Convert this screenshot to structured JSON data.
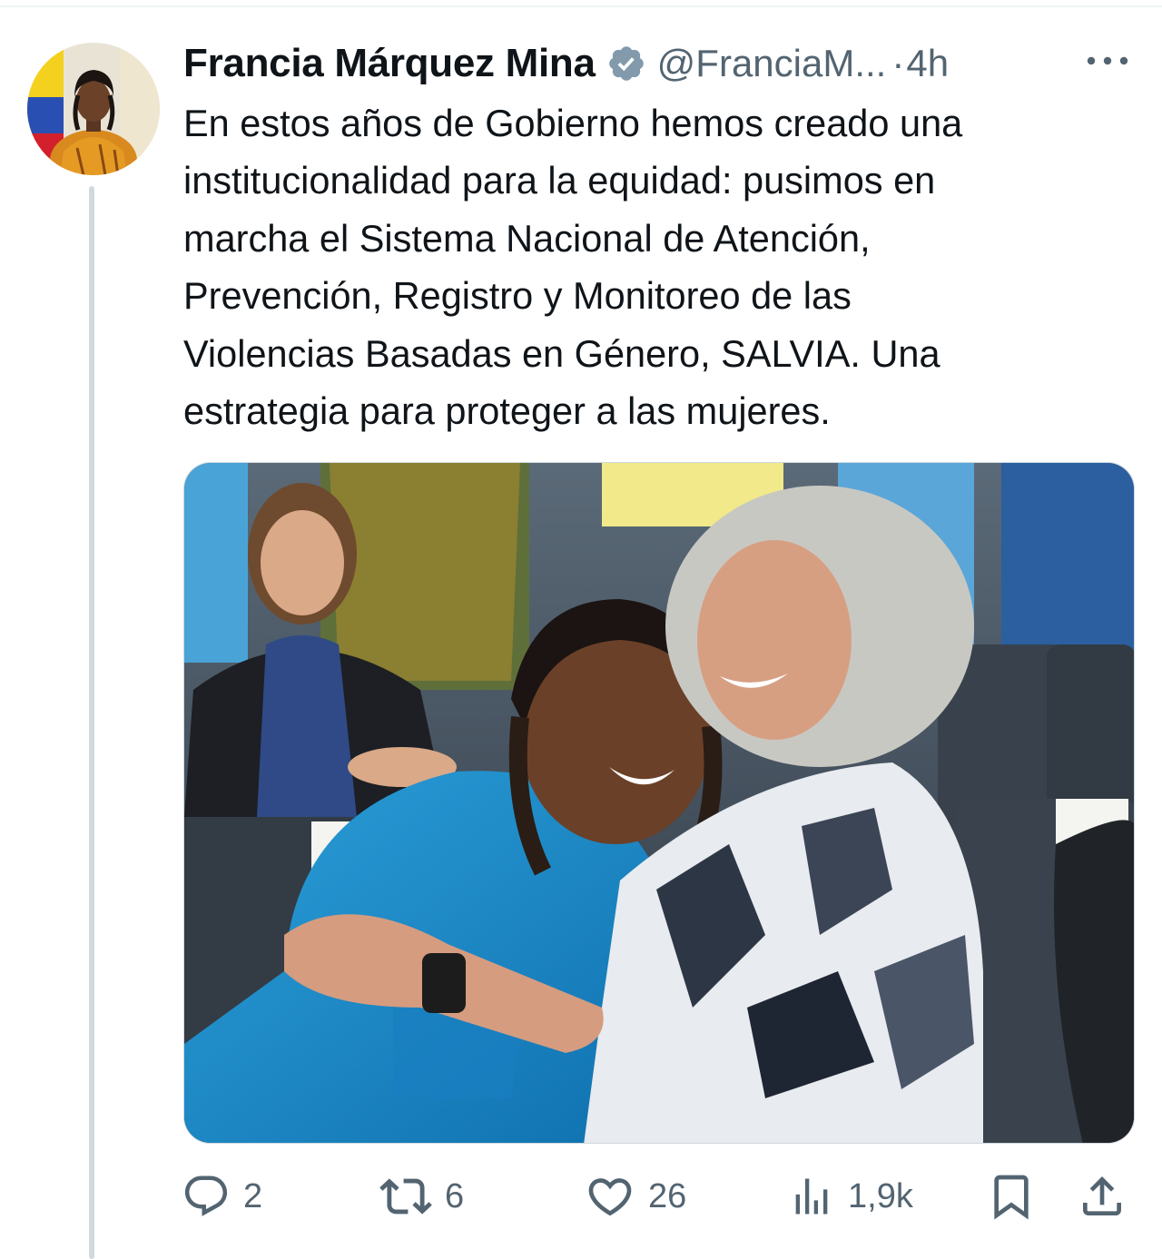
{
  "tweet": {
    "author_name": "Francia Márquez Mina",
    "handle": "@FranciaM...",
    "separator": "·",
    "time": "4h",
    "text": "En estos años de Gobierno hemos creado una\ninstitucionalidad para la equidad: pusimos en\nmarcha el Sistema Nacional de Atención,\nPrevención, Registro y Monitoreo de las\nViolencias Basadas en Género, SALVIA. Una\nestrategia para proteger a las mujeres."
  },
  "actions": {
    "replies": "2",
    "reposts": "6",
    "likes": "26",
    "views": "1,9k"
  },
  "icons": {
    "verified": "verified-badge-icon",
    "more": "more-icon",
    "reply": "reply-icon",
    "repost": "repost-icon",
    "like": "like-icon",
    "views": "views-icon",
    "bookmark": "bookmark-icon",
    "share": "share-icon"
  },
  "colors": {
    "text": "#0f1419",
    "muted": "#536471",
    "verified": "#829aab",
    "thread_line": "#cfd9de"
  }
}
